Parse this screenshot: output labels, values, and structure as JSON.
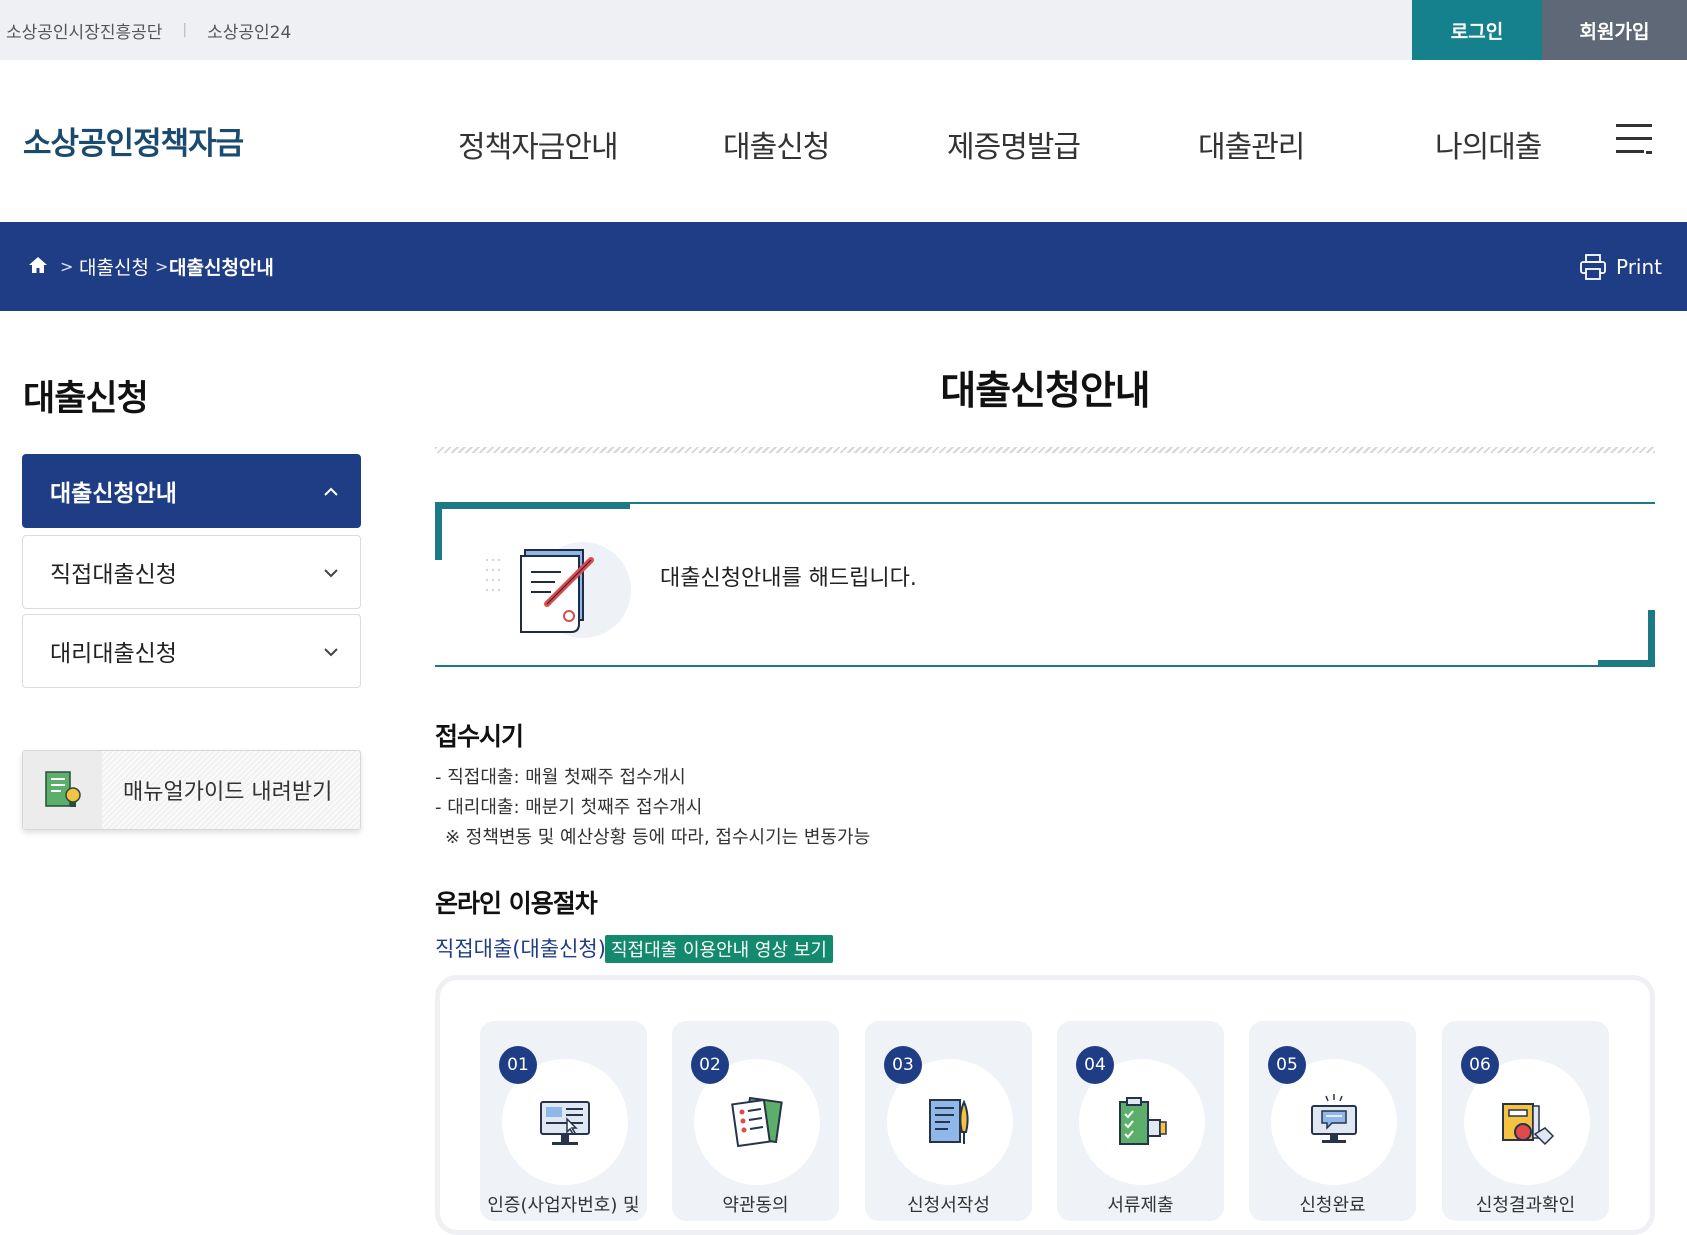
{
  "util": {
    "links": [
      "소상공인시장진흥공단",
      "소상공인24"
    ],
    "login": "로그인",
    "join": "회원가입"
  },
  "header": {
    "logo": "소상공인정책자금",
    "nav": [
      "정책자금안내",
      "대출신청",
      "제증명발급",
      "대출관리",
      "나의대출"
    ],
    "menu_icon": "hamburger-menu-icon"
  },
  "breadcrumb": {
    "home_icon": "home-icon",
    "items": [
      "대출신청",
      "대출신청안내"
    ],
    "print": "Print"
  },
  "sidebar": {
    "title": "대출신청",
    "items": [
      {
        "label": "대출신청안내",
        "active": true
      },
      {
        "label": "직접대출신청",
        "active": false
      },
      {
        "label": "대리대출신청",
        "active": false
      }
    ],
    "manual": "매뉴얼가이드 내려받기"
  },
  "main": {
    "title": "대출신청안내",
    "intro": "대출신청안내를 해드립니다.",
    "reception": {
      "title": "접수시기",
      "lines": [
        "- 직접대출: 매월 첫째주 접수개시",
        "- 대리대출: 매분기 첫째주 접수개시",
        "※ 정책변동 및 예산상황 등에 따라, 접수시기는 변동가능"
      ]
    },
    "procedure": {
      "title": "온라인 이용절차",
      "subtitle": "직접대출(대출신청)",
      "video_button": "직접대출 이용안내 영상 보기",
      "steps": [
        {
          "num": "01",
          "label": "인증(사업자번호) 및",
          "icon": "computer-cursor-icon"
        },
        {
          "num": "02",
          "label": "약관동의",
          "icon": "document-checklist-icon"
        },
        {
          "num": "03",
          "label": "신청서작성",
          "icon": "document-pen-icon"
        },
        {
          "num": "04",
          "label": "서류제출",
          "icon": "clipboard-hand-icon"
        },
        {
          "num": "05",
          "label": "신청완료",
          "icon": "monitor-chat-icon"
        },
        {
          "num": "06",
          "label": "신청결과확인",
          "icon": "folder-magnifier-icon"
        }
      ]
    }
  },
  "colors": {
    "navy": "#1f3d85",
    "teal": "#14818d",
    "green": "#138a6e",
    "gray_button": "#5f6877"
  }
}
